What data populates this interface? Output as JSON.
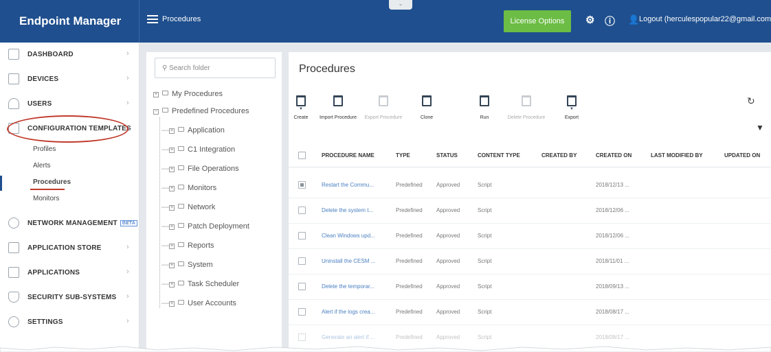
{
  "app": {
    "title": "Endpoint Manager"
  },
  "header": {
    "breadcrumb": "Procedures",
    "license_button": "License Options",
    "logout": "Logout (herculespopular22@gmail.com)"
  },
  "sidebar": {
    "items": [
      {
        "label": "DASHBOARD"
      },
      {
        "label": "DEVICES"
      },
      {
        "label": "USERS"
      },
      {
        "label": "CONFIGURATION TEMPLATES"
      },
      {
        "label": "NETWORK MANAGEMENT",
        "badge": "BETA"
      },
      {
        "label": "APPLICATION STORE"
      },
      {
        "label": "APPLICATIONS"
      },
      {
        "label": "SECURITY SUB-SYSTEMS"
      },
      {
        "label": "SETTINGS"
      }
    ],
    "subitems": [
      "Profiles",
      "Alerts",
      "Procedures",
      "Monitors"
    ]
  },
  "folders": {
    "search_placeholder": "Search folder",
    "roots": [
      "My Procedures",
      "Predefined Procedures"
    ],
    "children": [
      "Application",
      "C1 Integration",
      "File Operations",
      "Monitors",
      "Network",
      "Patch Deployment",
      "Reports",
      "System",
      "Task Scheduler",
      "User Accounts"
    ]
  },
  "main": {
    "title": "Procedures",
    "toolbar": [
      "Create",
      "Import Procedure",
      "Export Procedure",
      "Clone",
      "Run",
      "Delete Procedure",
      "Export"
    ],
    "columns": [
      "PROCEDURE NAME",
      "TYPE",
      "STATUS",
      "CONTENT TYPE",
      "CREATED BY",
      "CREATED ON",
      "LAST MODIFIED BY",
      "UPDATED ON"
    ],
    "rows": [
      {
        "name": "Restart the Commu...",
        "type": "Predefined",
        "status": "Approved",
        "content": "Script",
        "created_on": "2018/12/13 ..."
      },
      {
        "name": "Delete the system t...",
        "type": "Predefined",
        "status": "Approved",
        "content": "Script",
        "created_on": "2018/12/06 ..."
      },
      {
        "name": "Clean Windows upd...",
        "type": "Predefined",
        "status": "Approved",
        "content": "Script",
        "created_on": "2018/12/06 ..."
      },
      {
        "name": "Uninstall the CESM ...",
        "type": "Predefined",
        "status": "Approved",
        "content": "Script",
        "created_on": "2018/11/01 ..."
      },
      {
        "name": "Delete the temporar...",
        "type": "Predefined",
        "status": "Approved",
        "content": "Script",
        "created_on": "2018/09/13 ..."
      },
      {
        "name": "Alert if the logs crea...",
        "type": "Predefined",
        "status": "Approved",
        "content": "Script",
        "created_on": "2018/08/17 ..."
      },
      {
        "name": "Generate an alert if ...",
        "type": "Predefined",
        "status": "Approved",
        "content": "Script",
        "created_on": "2018/08/17 ..."
      }
    ]
  },
  "colors": {
    "header": "#1f4f8e",
    "license": "#6cbd45",
    "link": "#4a7fc1",
    "highlight": "#c0392b"
  }
}
